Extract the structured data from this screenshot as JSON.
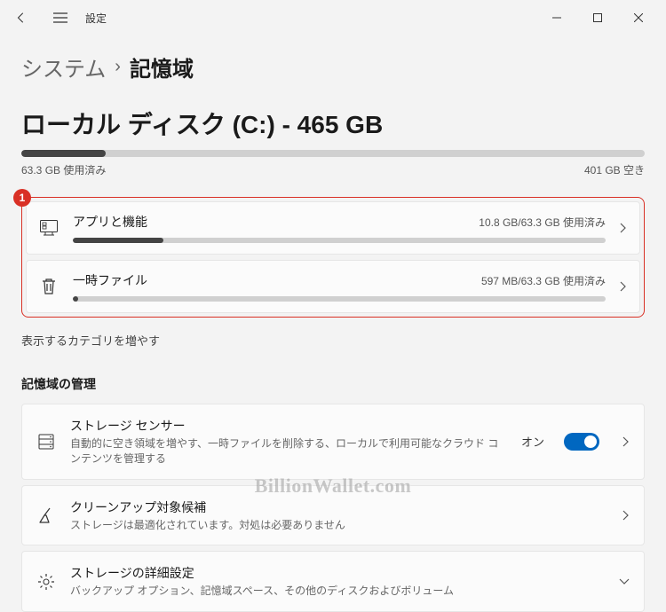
{
  "titlebar": {
    "title": "設定"
  },
  "breadcrumb": {
    "parent": "システム",
    "sep": "›",
    "current": "記憶域"
  },
  "disk": {
    "title": "ローカル ディスク (C:) - 465 GB",
    "used_label": "63.3 GB 使用済み",
    "free_label": "401 GB 空き",
    "used_pct": 13.6
  },
  "categories": [
    {
      "id": "apps",
      "title": "アプリと機能",
      "stat": "10.8 GB/63.3 GB 使用済み",
      "pct": 17
    },
    {
      "id": "temp",
      "title": "一時ファイル",
      "stat": "597 MB/63.3 GB 使用済み",
      "pct": 1
    }
  ],
  "more_link": "表示するカテゴリを増やす",
  "mgmt_header": "記憶域の管理",
  "mgmt": [
    {
      "id": "sense",
      "title": "ストレージ センサー",
      "sub": "自動的に空き領域を増やす、一時ファイルを削除する、ローカルで利用可能なクラウド コンテンツを管理する",
      "toggle": true,
      "toggle_label": "オン"
    },
    {
      "id": "cleanup",
      "title": "クリーンアップ対象候補",
      "sub": "ストレージは最適化されています。対処は必要ありません"
    },
    {
      "id": "advanced",
      "title": "ストレージの詳細設定",
      "sub": "バックアップ オプション、記憶域スペース、その他のディスクおよびボリューム"
    }
  ],
  "annotation": "1",
  "watermark": "BillionWallet.com"
}
